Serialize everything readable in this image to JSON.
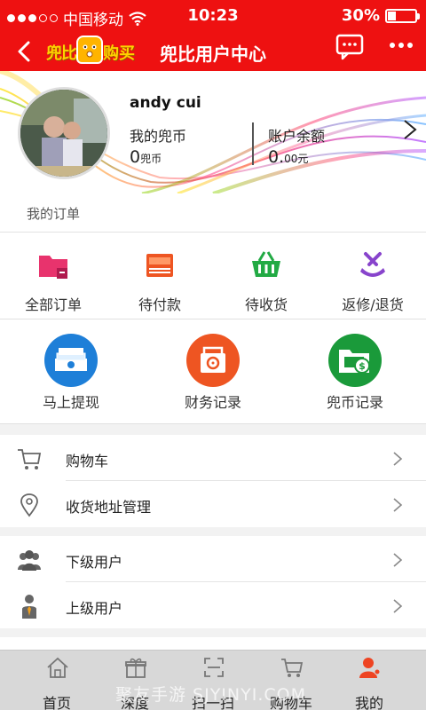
{
  "status_bar": {
    "carrier": "中国移动",
    "time": "10:23",
    "battery": "30%",
    "battery_level": 0.3
  },
  "header": {
    "title": "兜比用户中心",
    "logo_text_left": "兜比",
    "logo_text_right": "购买"
  },
  "profile": {
    "username": "andy cui",
    "coins_label": "我的兜币",
    "coins_value": "0",
    "coins_unit": "兜币",
    "balance_label": "账户余额",
    "balance_value": "0.",
    "balance_unit": "00元"
  },
  "orders_section": {
    "title": "我的订单"
  },
  "orders": [
    {
      "label": "全部订单",
      "icon": "folder-icon",
      "color": "#e8336d"
    },
    {
      "label": "待付款",
      "icon": "wallet-icon",
      "color": "#ee5522"
    },
    {
      "label": "待收货",
      "icon": "basket-icon",
      "color": "#22aa44"
    },
    {
      "label": "返修/退货",
      "icon": "repair-icon",
      "color": "#8844cc"
    }
  ],
  "finance": [
    {
      "label": "马上提现",
      "icon": "cash-stack-icon",
      "color": "#1e7fd8"
    },
    {
      "label": "财务记录",
      "icon": "safe-icon",
      "color": "#ee5522"
    },
    {
      "label": "兜币记录",
      "icon": "money-folder-icon",
      "color": "#1a9a3a"
    }
  ],
  "menu_group_1": [
    {
      "label": "购物车",
      "icon": "cart-icon"
    },
    {
      "label": "收货地址管理",
      "icon": "location-pin-icon"
    }
  ],
  "menu_group_2": [
    {
      "label": "下级用户",
      "icon": "users-icon"
    },
    {
      "label": "上级用户",
      "icon": "manager-icon"
    }
  ],
  "tabs": [
    {
      "label": "首页",
      "icon": "home-icon",
      "active": false
    },
    {
      "label": "深度",
      "icon": "gift-icon",
      "active": false
    },
    {
      "label": "扫一扫",
      "icon": "scan-icon",
      "active": false
    },
    {
      "label": "购物车",
      "icon": "cart-icon",
      "active": false
    },
    {
      "label": "我的",
      "icon": "person-icon",
      "active": true
    }
  ],
  "watermark": "聚友手游 SJYINYI.COM",
  "colors": {
    "brand_red": "#ee1111",
    "tab_active": "#ee4422"
  }
}
